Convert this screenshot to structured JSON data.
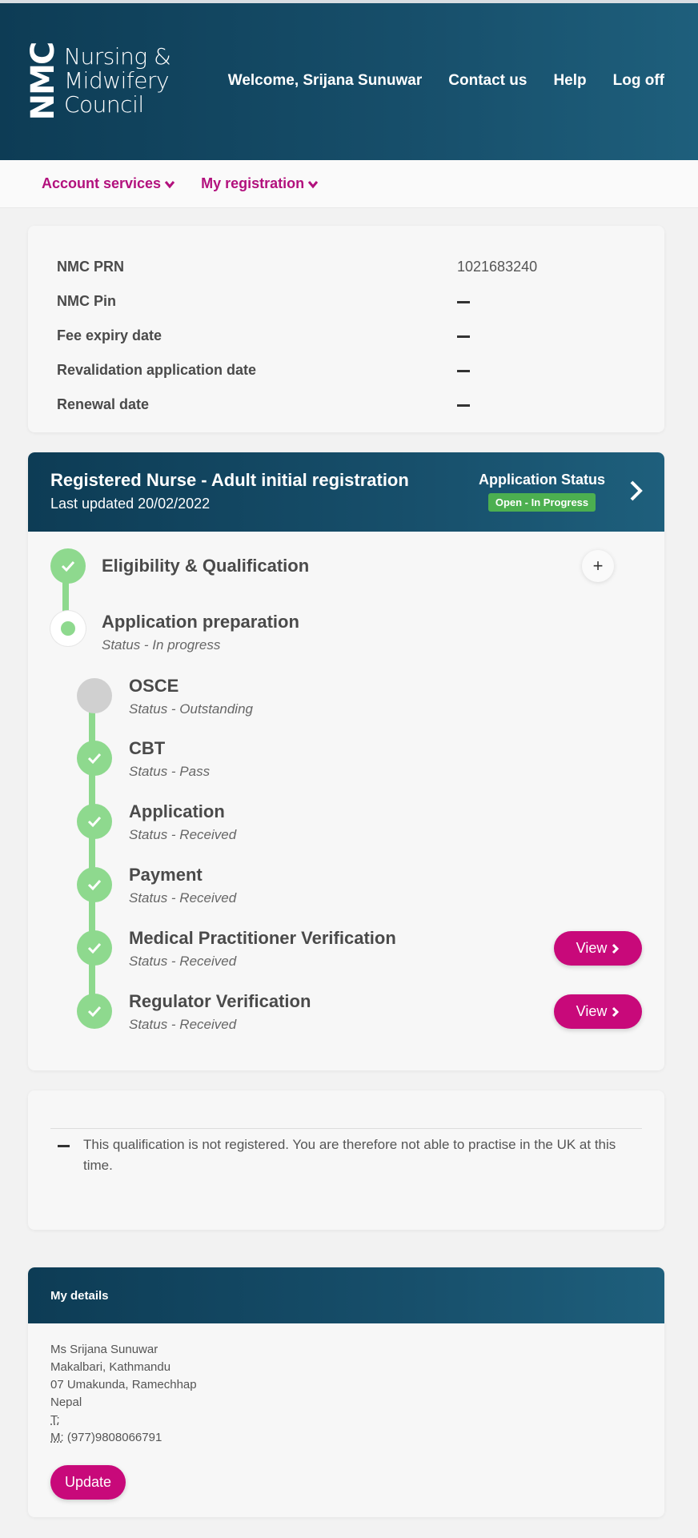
{
  "header": {
    "logo_mark": "NMC",
    "logo_lines": [
      "Nursing &",
      "Midwifery",
      "Council"
    ],
    "nav": {
      "welcome": "Welcome, Srijana Sunuwar",
      "contact": "Contact us",
      "help": "Help",
      "logoff": "Log off"
    }
  },
  "sub_nav": {
    "account_services": "Account services",
    "my_registration": "My registration"
  },
  "summary": {
    "rows": [
      {
        "label": "NMC PRN",
        "value": "1021683240"
      },
      {
        "label": "NMC Pin",
        "value": ""
      },
      {
        "label": "Fee expiry date",
        "value": ""
      },
      {
        "label": "Revalidation application date",
        "value": ""
      },
      {
        "label": "Renewal date",
        "value": ""
      }
    ]
  },
  "application": {
    "title": "Registered Nurse - Adult initial registration",
    "last_updated": "Last updated 20/02/2022",
    "status_label": "Application Status",
    "status_badge": "Open - In Progress",
    "steps": [
      {
        "title": "Eligibility & Qualification",
        "status": "",
        "state": "done"
      },
      {
        "title": "Application preparation",
        "status": "Status - In progress",
        "state": "current"
      }
    ],
    "substeps": [
      {
        "title": "OSCE",
        "status": "Status - Outstanding",
        "state": "pending"
      },
      {
        "title": "CBT",
        "status": "Status - Pass",
        "state": "done"
      },
      {
        "title": "Application",
        "status": "Status - Received",
        "state": "done"
      },
      {
        "title": "Payment",
        "status": "Status - Received",
        "state": "done"
      },
      {
        "title": "Medical Practitioner Verification",
        "status": "Status - Received",
        "state": "done"
      },
      {
        "title": "Regulator Verification",
        "status": "Status - Received",
        "state": "done"
      }
    ],
    "view_label": "View",
    "expand_symbol": "+"
  },
  "notice": {
    "message": "This qualification is not registered. You are therefore not able to practise in the UK at this time."
  },
  "details": {
    "heading": "My details",
    "name": "Ms Srijana Sunuwar",
    "address_1": "Makalbari, Kathmandu",
    "address_2": "07 Umakunda, Ramechhap",
    "country": "Nepal",
    "tel_label": "T:",
    "mobile_label": "M:",
    "mobile": "(977)9808066791",
    "update_label": "Update"
  },
  "colors": {
    "header_bg": "#0d3c55",
    "accent_magenta": "#c8097a",
    "success_green": "#8ed98e",
    "badge_green": "#4caf50"
  }
}
